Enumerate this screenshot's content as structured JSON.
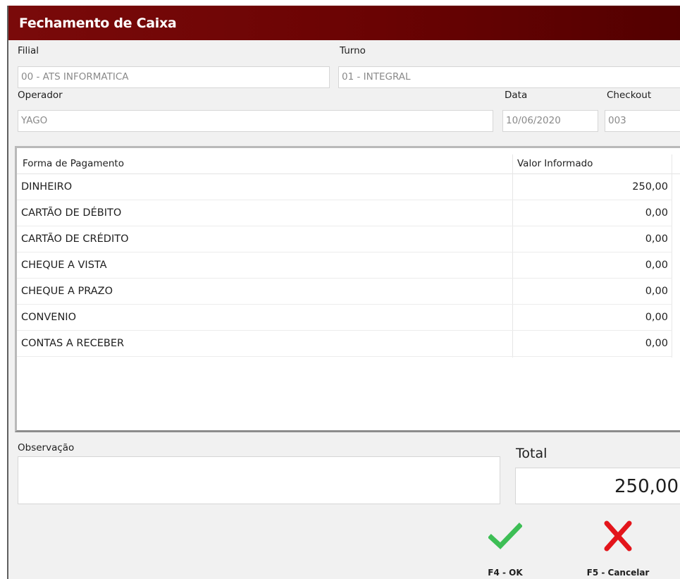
{
  "window": {
    "title": "Fechamento de Caixa"
  },
  "filial": {
    "label": "Filial",
    "value": "00 - ATS INFORMATICA"
  },
  "turno": {
    "label": "Turno",
    "value": "01 - INTEGRAL"
  },
  "operador": {
    "label": "Operador",
    "value": "YAGO"
  },
  "data": {
    "label": "Data",
    "value": "10/06/2020"
  },
  "checkout": {
    "label": "Checkout",
    "value": "003"
  },
  "grid": {
    "columns": [
      "Forma de Pagamento",
      "Valor Informado"
    ],
    "rows": [
      {
        "forma": "DINHEIRO",
        "valor": "250,00"
      },
      {
        "forma": "CARTÃO DE DÉBITO",
        "valor": "0,00"
      },
      {
        "forma": "CARTÃO DE CRÉDITO",
        "valor": "0,00"
      },
      {
        "forma": "CHEQUE A VISTA",
        "valor": "0,00"
      },
      {
        "forma": "CHEQUE A PRAZO",
        "valor": "0,00"
      },
      {
        "forma": "CONVENIO",
        "valor": "0,00"
      },
      {
        "forma": "CONTAS A RECEBER",
        "valor": "0,00"
      }
    ]
  },
  "observacao": {
    "label": "Observação",
    "value": ""
  },
  "total": {
    "label": "Total",
    "value": "250,00"
  },
  "buttons": {
    "ok": {
      "label": "F4 - OK",
      "icon": "check-icon",
      "color": "#3dbe55"
    },
    "cancel": {
      "label": "F5 - Cancelar",
      "icon": "close-icon",
      "color": "#e3151b"
    }
  },
  "colors": {
    "titlebar": "#6a0303",
    "background": "#f1f1f1"
  }
}
